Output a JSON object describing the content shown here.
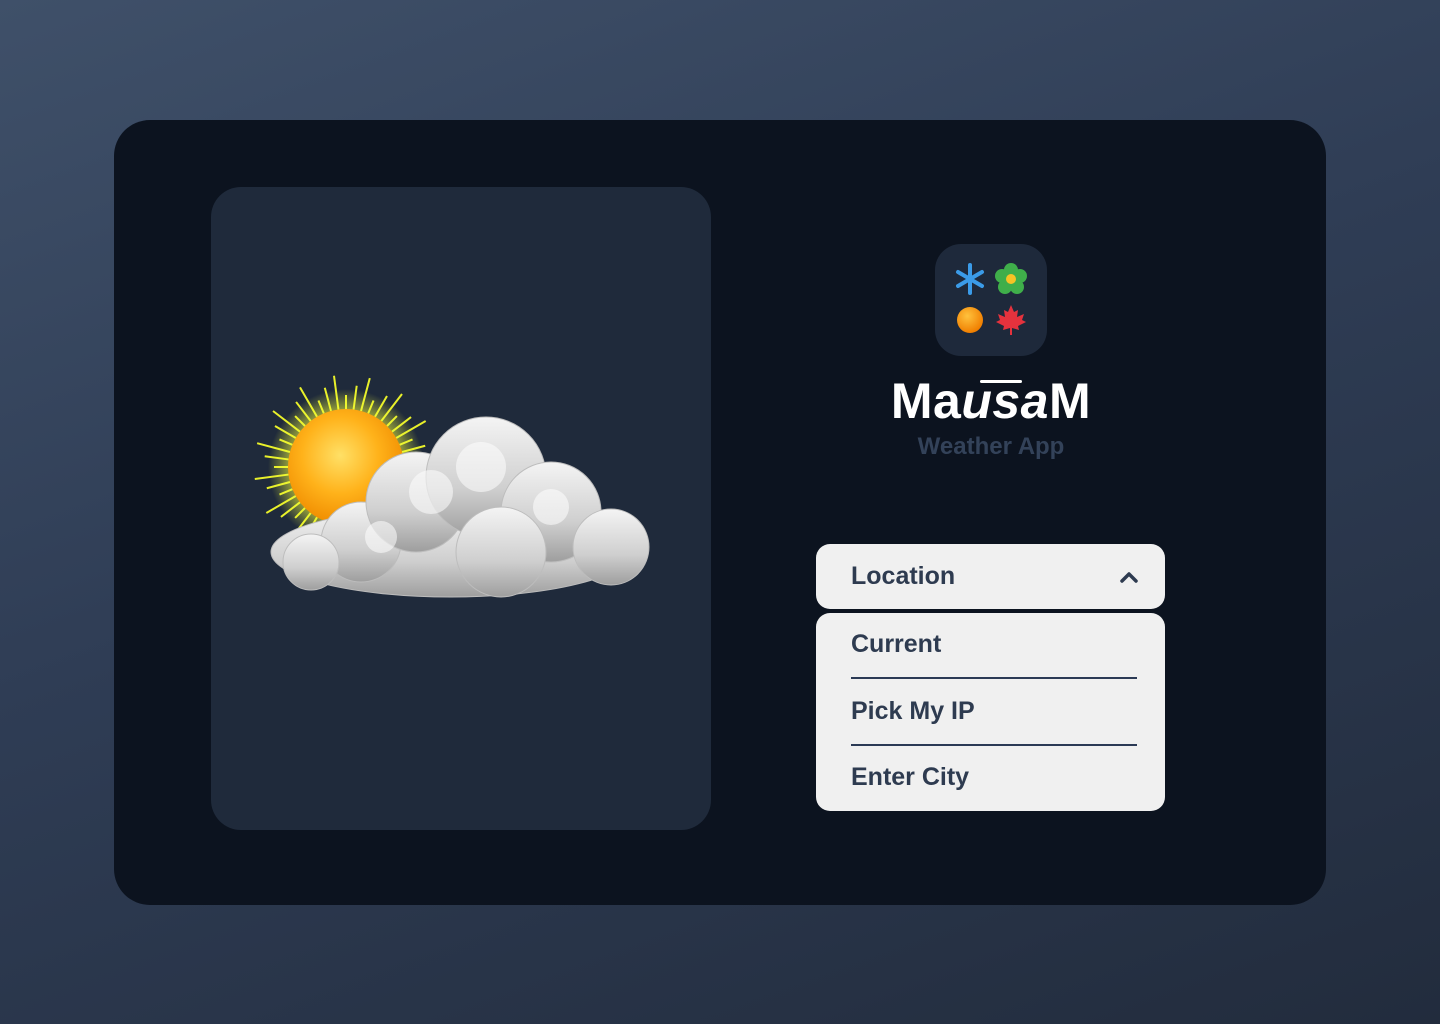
{
  "app": {
    "name_start": "Ma",
    "name_mid": "usa",
    "name_end": "M",
    "subtitle": "Weather App"
  },
  "logo": {
    "icons": [
      "snowflake-icon",
      "flower-icon",
      "sun-icon",
      "maple-leaf-icon"
    ],
    "colors": {
      "snowflake": "#3b9be8",
      "flower": "#3fae4a",
      "sun": "#f39c12",
      "leaf": "#e5323d"
    }
  },
  "hero": {
    "icon": "partly-cloudy-icon"
  },
  "location_dropdown": {
    "label": "Location",
    "expanded": true,
    "options": [
      "Current",
      "Pick My IP",
      "Enter City"
    ]
  },
  "theme": {
    "card_bg": "#0c131f",
    "panel_bg": "#1f2a3b",
    "dropdown_bg": "#f0f0f0",
    "text_dark": "#2e3b50"
  }
}
